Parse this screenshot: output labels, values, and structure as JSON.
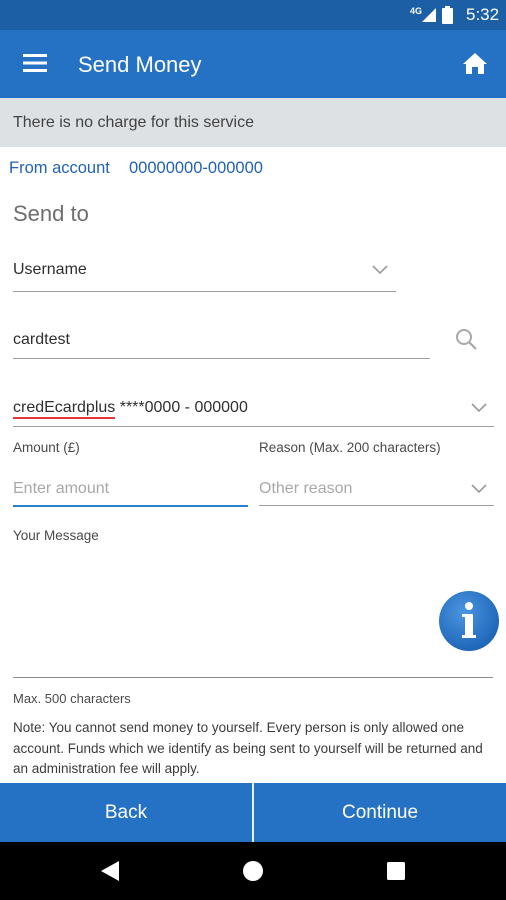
{
  "status_bar": {
    "network": "4G",
    "time": "5:32"
  },
  "app_bar": {
    "title": "Send Money"
  },
  "banner": {
    "text": "There is no charge for this service"
  },
  "from_account": {
    "label": "From account",
    "value": "00000000-000000"
  },
  "send_to": {
    "heading": "Send to",
    "lookup_type": "Username",
    "lookup_value": "cardtest",
    "recipient_name": "credEcardplus",
    "recipient_account": " ****0000 - 000000"
  },
  "amount": {
    "label": "Amount (£)",
    "placeholder": "Enter amount"
  },
  "reason": {
    "label": "Reason (Max. 200 characters)",
    "placeholder": "Other reason"
  },
  "message": {
    "label": "Your Message",
    "limit": "Max. 500 characters",
    "note": "Note: You cannot send money to yourself. Every person is only allowed one account. Funds which we identify as being sent to yourself will be returned and an administration fee will apply."
  },
  "buttons": {
    "back": "Back",
    "continue": "Continue"
  },
  "colors": {
    "primary": "#2571c4",
    "status_bar": "#1c5fa5",
    "banner": "#dde1e4",
    "accent_underline": "#2a7fd4",
    "info_button": "#2a77cf"
  }
}
